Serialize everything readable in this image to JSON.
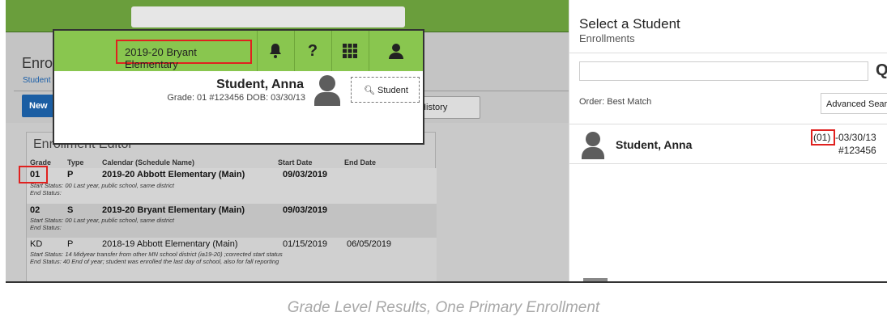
{
  "background": {
    "title_fragment": "Enro",
    "crumb_fragment": "Student",
    "new_button_fragment": "New",
    "history_button_fragment": "t History",
    "editor_title": "Enrollment Editor",
    "columns": [
      "Grade",
      "Type",
      "Calendar (Schedule Name)",
      "Start Date",
      "End Date"
    ],
    "rows": [
      {
        "grade": "01",
        "type": "P",
        "calendar": "2019-20 Abbott Elementary (Main)",
        "start": "09/03/2019",
        "end": "",
        "start_status": "Start Status: 00 Last year, public school, same district",
        "end_status": "End Status:"
      },
      {
        "grade": "02",
        "type": "S",
        "calendar": "2019-20 Bryant Elementary (Main)",
        "start": "09/03/2019",
        "end": "",
        "start_status": "Start Status: 00 Last year, public school, same district",
        "end_status": "End Status:"
      },
      {
        "grade": "KD",
        "type": "P",
        "calendar": "2018-19 Abbott Elementary (Main)",
        "start": "01/15/2019",
        "end": "06/05/2019",
        "start_status": "Start Status: 14 Midyear transfer from other MN school district (ia19-20) ;corrected start status",
        "end_status": "End Status: 40 End of year; student was enrolled the last day of school, also for fall reporting"
      }
    ]
  },
  "popup": {
    "school": "2019-20 Bryant Elementary",
    "question_glyph": "?",
    "student_name": "Student, Anna",
    "student_meta": "Grade: 01 #123456 DOB: 03/30/13",
    "student_button": "Student"
  },
  "panel": {
    "title": "Select a Student",
    "subtitle": "Enrollments",
    "search_value": "",
    "order_label": "Order: Best Match",
    "advanced_button": "Advanced Search",
    "result": {
      "name": "Student, Anna",
      "grade": "(01)",
      "dob": "-03/30/13",
      "id": "#123456"
    }
  },
  "caption": "Grade Level Results, One Primary Enrollment",
  "colors": {
    "topbar": "#6a9e3c",
    "popup_bar": "#89c64f",
    "highlight": "#e0211f",
    "button_blue": "#1b5ea3"
  }
}
